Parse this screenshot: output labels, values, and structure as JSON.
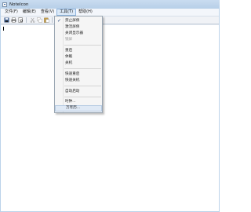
{
  "window": {
    "title": "NoteIcon"
  },
  "menubar": {
    "items": [
      {
        "label": "文件(F)"
      },
      {
        "label": "编辑(E)"
      },
      {
        "label": "查看(V)"
      },
      {
        "label": "工具(T)"
      },
      {
        "label": "帮助(H)"
      }
    ]
  },
  "toolbar": {
    "icons": [
      "save-icon",
      "print-icon",
      "preview-icon",
      "cut-icon",
      "copy-icon",
      "paste-icon",
      "find-icon",
      "zoom-icon",
      "help-icon"
    ]
  },
  "tools_menu": {
    "items": [
      {
        "label": "禁止屏保",
        "checked": true
      },
      {
        "label": "激活屏保"
      },
      {
        "label": "关闭显示器"
      },
      {
        "label": "锁屏",
        "disabled": true
      },
      {
        "label": "重启"
      },
      {
        "label": "休眠"
      },
      {
        "label": "关机"
      },
      {
        "label": "快速重启"
      },
      {
        "label": "快速关机"
      },
      {
        "label": "自动启动"
      },
      {
        "label": "时钟..."
      },
      {
        "label": "万年历..."
      }
    ],
    "check_mark": "✓"
  }
}
